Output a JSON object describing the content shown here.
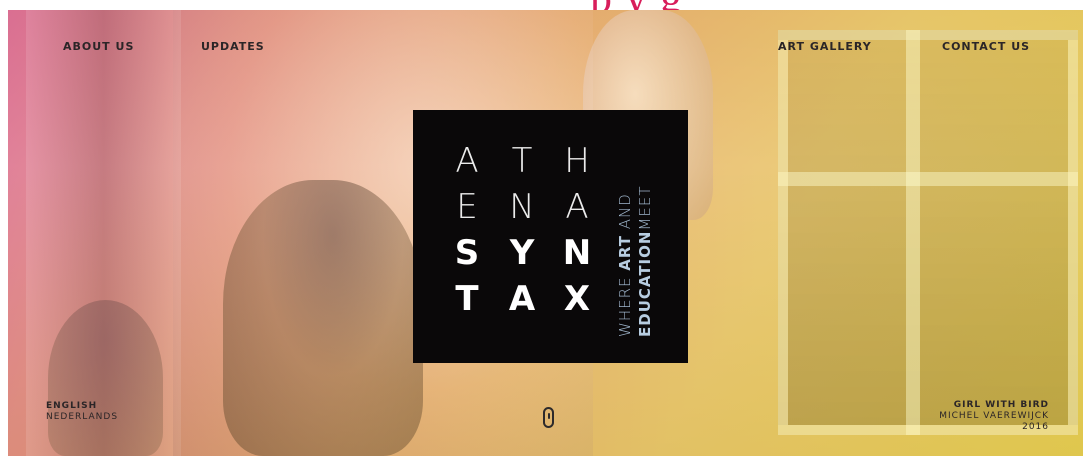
{
  "top_heading": "p        y     g",
  "nav": {
    "left": [
      "ABOUT US",
      "UPDATES"
    ],
    "right": [
      "ART GALLERY",
      "CONTACT US"
    ]
  },
  "logo": {
    "rows": [
      [
        "A",
        "T",
        "H"
      ],
      [
        "E",
        "N",
        "A"
      ],
      [
        "S",
        "Y",
        "N"
      ],
      [
        "T",
        "A",
        "X"
      ]
    ],
    "tagline_line1": [
      "WHERE ",
      "ART",
      " AND"
    ],
    "tagline_line2": [
      "EDUCATION",
      "MEET"
    ]
  },
  "languages": [
    "ENGLISH",
    "NEDERLANDS"
  ],
  "credit": {
    "title": "GIRL WITH BIRD",
    "artist": "MICHEL VAEREWIJCK",
    "year": "2016"
  },
  "colors": {
    "heading_accent": "#d81e5b",
    "logo_background": "#0a0809",
    "tagline": "#a8bfd6",
    "hero_gradient": [
      "#da5e9a",
      "#e9a770",
      "#e3cc4b"
    ]
  },
  "icons": {
    "scroll": "mouse-scroll-icon"
  }
}
